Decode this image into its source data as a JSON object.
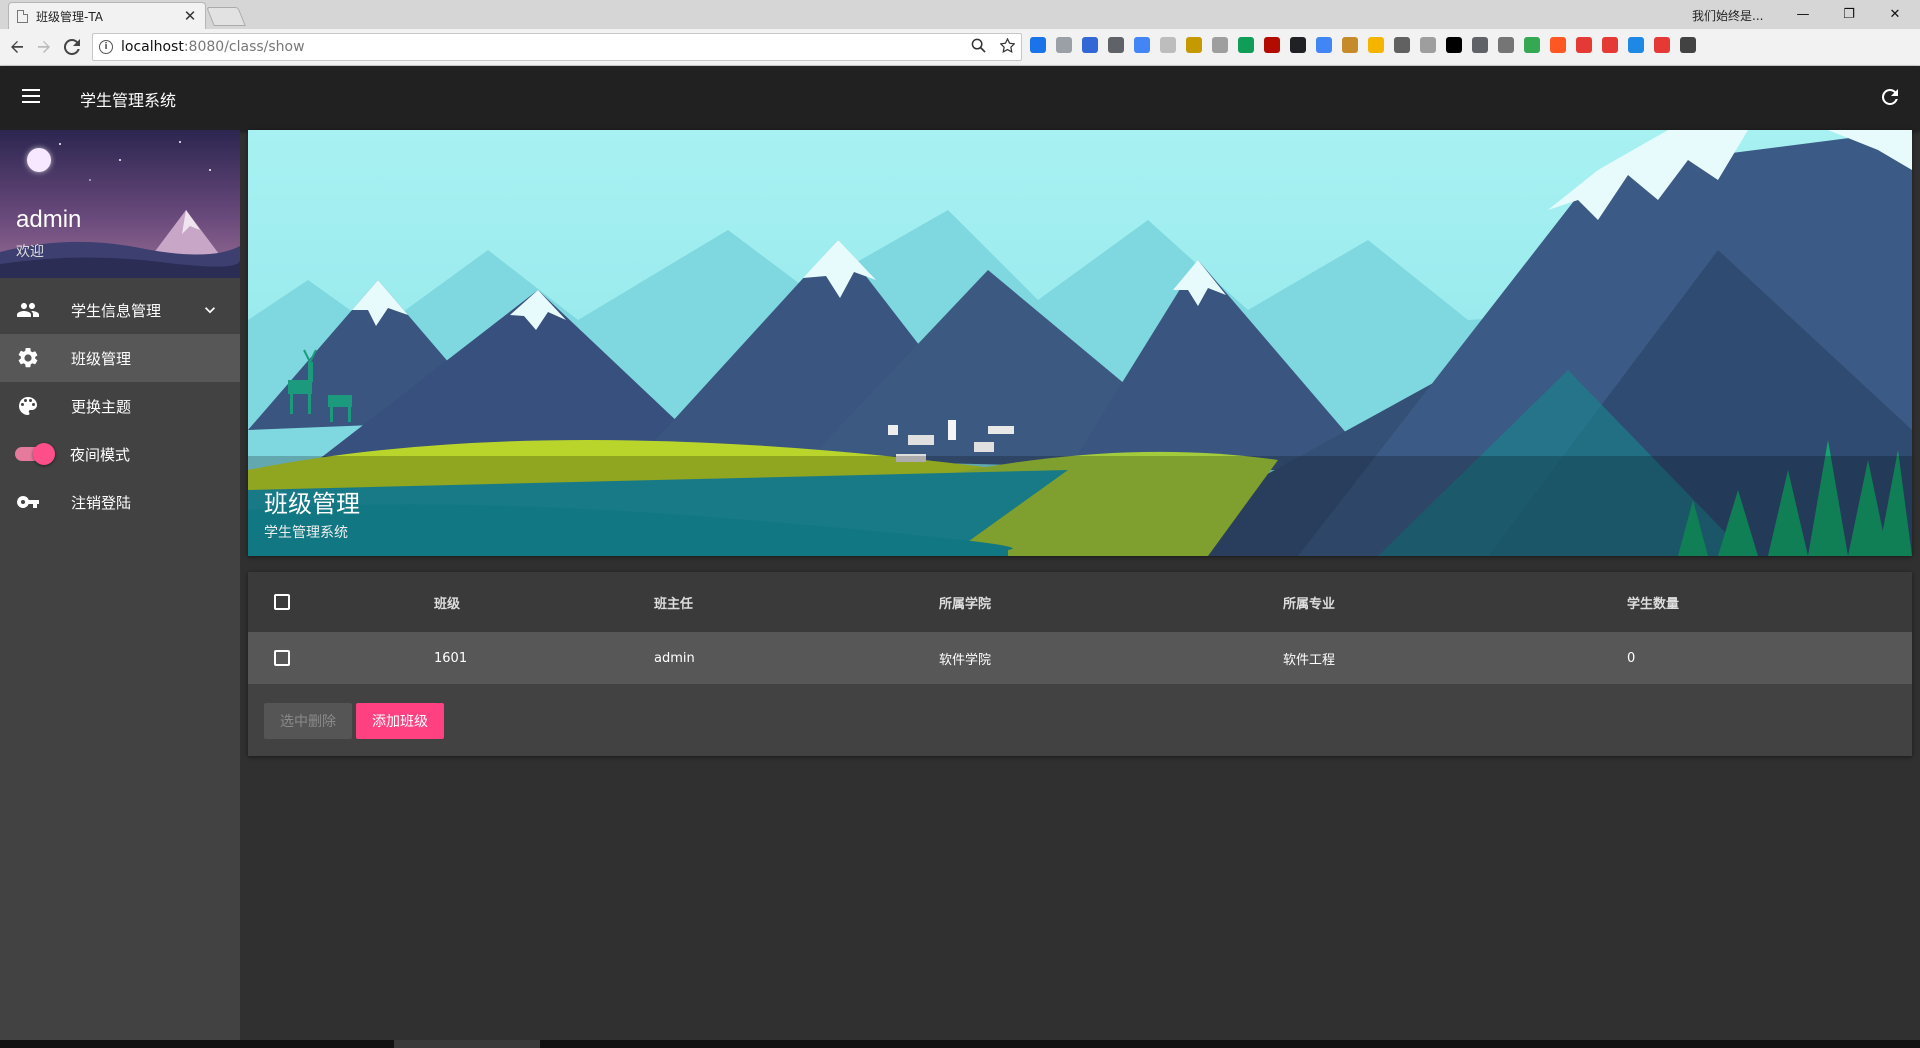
{
  "browser": {
    "tab_title": "班级管理-TA",
    "tab_close": "✕",
    "profile": "我们始终是...",
    "window_controls": {
      "minimize": "—",
      "restore": "❐",
      "close": "✕"
    },
    "url_host": "localhost",
    "url_path": ":8080/class/show",
    "extension_colors": [
      "#1a73e8",
      "#9aa0a6",
      "#3367d6",
      "#5f6368",
      "#4285f4",
      "#bdbdbd",
      "#c49a00",
      "#9e9e9e",
      "#0f9d58",
      "#b30b00",
      "#202124",
      "#4285f4",
      "#c58b2b",
      "#f4b400",
      "#616161",
      "#9e9e9e",
      "#000000",
      "#5f6368",
      "#757575",
      "#34a853",
      "#ff5722",
      "#e53935",
      "#e53935",
      "#1e88e5",
      "#e53935",
      "#424242"
    ]
  },
  "appbar": {
    "title": "学生管理系统"
  },
  "sidebar": {
    "user_name": "admin",
    "user_subtitle": "欢迎",
    "items": [
      {
        "label": "学生信息管理",
        "icon": "people-icon",
        "active": false
      },
      {
        "label": "班级管理",
        "icon": "gear-icon",
        "active": true
      },
      {
        "label": "更换主题",
        "icon": "palette-icon",
        "active": false
      },
      {
        "label": "夜间模式",
        "icon": "toggle",
        "active": false,
        "toggle_on": true
      },
      {
        "label": "注销登陆",
        "icon": "key-icon",
        "active": false
      }
    ]
  },
  "hero": {
    "title": "班级管理",
    "subtitle": "学生管理系统"
  },
  "table": {
    "columns": [
      "班级",
      "班主任",
      "所属学院",
      "所属专业",
      "学生数量"
    ],
    "rows": [
      {
        "class": "1601",
        "teacher": "admin",
        "college": "软件学院",
        "major": "软件工程",
        "count": "0"
      }
    ]
  },
  "actions": {
    "delete_selected": "选中删除",
    "add_class": "添加班级"
  },
  "colors": {
    "appbar": "#212121",
    "sidebar": "#424242",
    "background": "#303030",
    "accent": "#ff4081"
  }
}
